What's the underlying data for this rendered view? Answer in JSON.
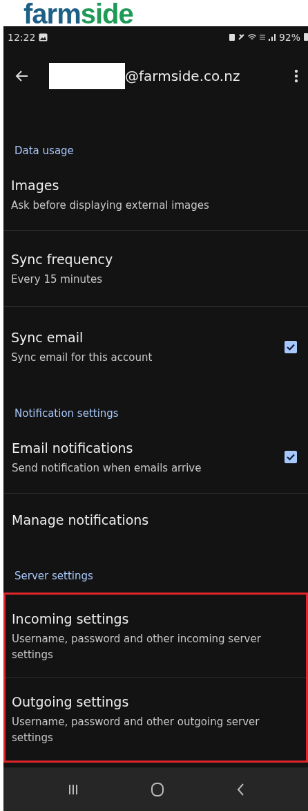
{
  "logo": {
    "parts": [
      {
        "text": "farm",
        "color": "#1e5f86"
      },
      {
        "text": "side",
        "color": "#1e9a57"
      }
    ]
  },
  "status_bar": {
    "time": "12:22",
    "battery": "92%"
  },
  "app_bar": {
    "account_suffix": "@farmside.co.nz",
    "redacted": true
  },
  "sections": [
    {
      "header": "Data usage",
      "highlighted": false,
      "items": [
        {
          "title": "Images",
          "subtitle": "Ask before displaying external images",
          "kind": "plain"
        },
        {
          "title": "Sync frequency",
          "subtitle": "Every 15 minutes",
          "kind": "plain"
        },
        {
          "title": "Sync email",
          "subtitle": "Sync email for this account",
          "kind": "checkbox",
          "checked": true
        }
      ]
    },
    {
      "header": "Notification settings",
      "highlighted": false,
      "items": [
        {
          "title": "Email notifications",
          "subtitle": "Send notification when emails arrive",
          "kind": "checkbox",
          "checked": true
        },
        {
          "title": "Manage notifications",
          "kind": "plain"
        }
      ]
    },
    {
      "header": "Server settings",
      "highlighted": true,
      "items": [
        {
          "title": "Incoming settings",
          "subtitle": "Username, password and other incoming server settings",
          "kind": "plain"
        },
        {
          "title": "Outgoing settings",
          "subtitle": "Username, password and other outgoing server settings",
          "kind": "plain"
        }
      ]
    }
  ]
}
